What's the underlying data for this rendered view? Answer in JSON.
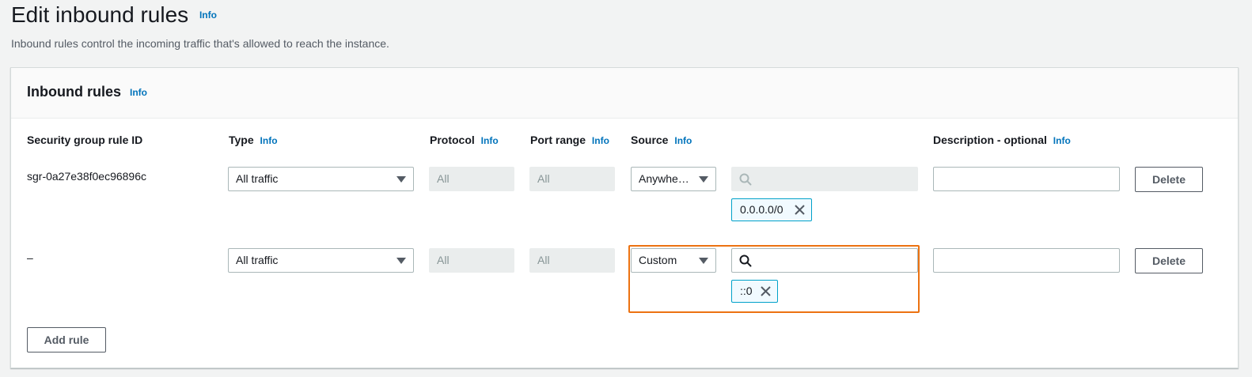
{
  "page": {
    "title": "Edit inbound rules",
    "info_label": "Info",
    "description": "Inbound rules control the incoming traffic that's allowed to reach the instance."
  },
  "panel": {
    "title": "Inbound rules",
    "info_label": "Info"
  },
  "columns": {
    "rule_id": "Security group rule ID",
    "type": "Type",
    "protocol": "Protocol",
    "port_range": "Port range",
    "source": "Source",
    "description": "Description - optional",
    "info_label": "Info"
  },
  "rules": [
    {
      "rule_id": "sgr-0a27e38f0ec96896c",
      "type": "All traffic",
      "protocol": "All",
      "port_range": "All",
      "source_type": "Anywhe…",
      "source_search_value": "",
      "source_token": "0.0.0.0/0",
      "description": "",
      "delete_label": "Delete"
    },
    {
      "rule_id": "–",
      "type": "All traffic",
      "protocol": "All",
      "port_range": "All",
      "source_type": "Custom",
      "source_search_value": "",
      "source_token": "::0",
      "description": "",
      "delete_label": "Delete"
    }
  ],
  "add_rule_label": "Add rule",
  "colors": {
    "accent_link": "#0073bb",
    "token_border": "#00a1c9",
    "focus_highlight": "#ec7211"
  },
  "icons": {
    "search": "search-icon",
    "token_remove": "close-icon",
    "dropdown": "caret-down-icon"
  }
}
